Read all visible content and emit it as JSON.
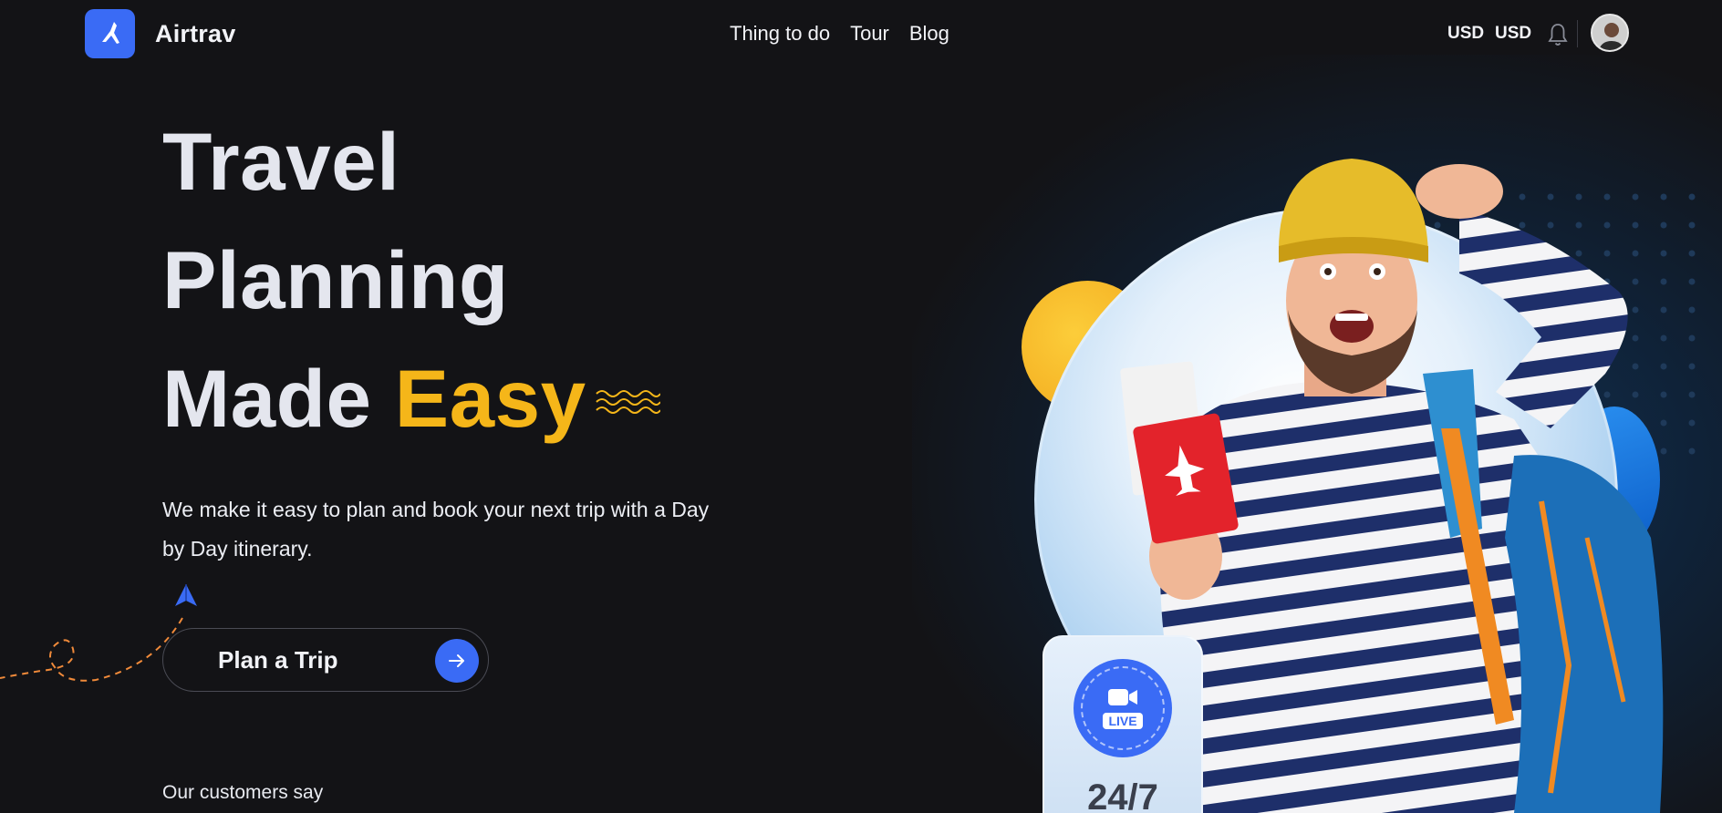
{
  "header": {
    "brand": "Airtrav",
    "nav": [
      "Thing to do",
      "Tour",
      "Blog"
    ],
    "currency_1": "USD",
    "currency_2": "USD"
  },
  "hero": {
    "line1": "Travel",
    "line2": "Planning",
    "line3_start": "Made ",
    "line3_accent": "Easy",
    "subtitle": "We make it easy to plan and book your next trip with a Day by Day itinerary.",
    "cta_label": "Plan a Trip",
    "customers_heading": "Our customers say"
  },
  "live_card": {
    "badge": "LIVE",
    "hours": "24/7"
  },
  "colors": {
    "background": "#131316",
    "accent_blue": "#3a6bf5",
    "accent_yellow": "#f5b619"
  },
  "icons": [
    "plane-logo-icon",
    "bell-icon",
    "paper-plane-icon",
    "arrow-right-icon",
    "video-camera-icon"
  ]
}
